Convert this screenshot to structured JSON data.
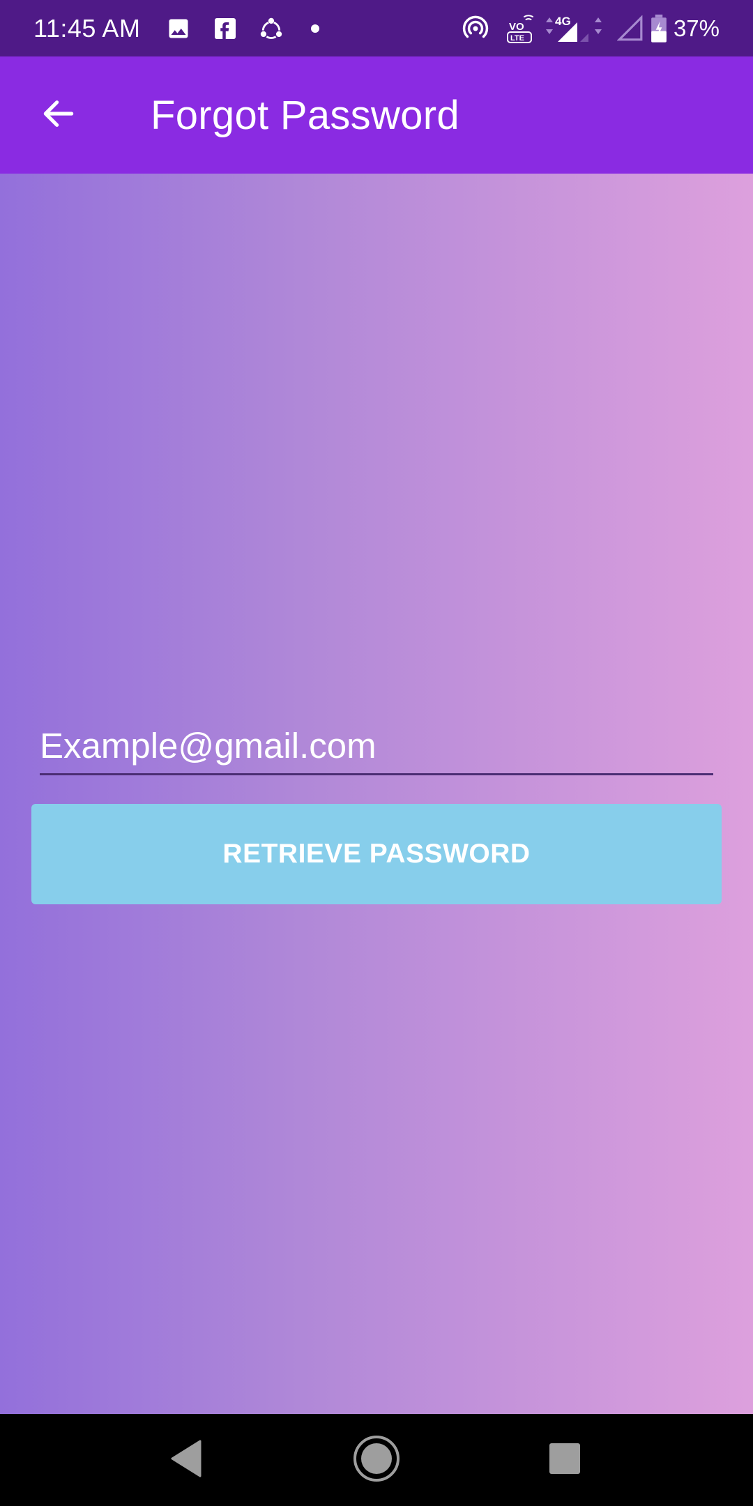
{
  "status_bar": {
    "time": "11:45 AM",
    "battery_percent": "37%",
    "network_label": "4G",
    "volte_top": "VO",
    "volte_bottom": "LTE",
    "icons": [
      "image-icon",
      "facebook-icon",
      "share-icon",
      "notification-dot-icon",
      "hotspot-icon",
      "volte-icon",
      "signal-4g-icon",
      "signal-empty-icon",
      "battery-icon"
    ]
  },
  "app_bar": {
    "title": "Forgot Password",
    "back_icon": "arrow-back-icon"
  },
  "form": {
    "email_placeholder": "Example@gmail.com",
    "email_value": "",
    "retrieve_label": "RETRIEVE PASSWORD"
  },
  "nav_bar": {
    "icons": [
      "back-triangle-icon",
      "home-circle-icon",
      "recents-square-icon"
    ]
  },
  "colors": {
    "status_bar": "#4f1a87",
    "app_bar": "#8a2be2",
    "gradient_start": "#9370db",
    "gradient_end": "#dda0dd",
    "button": "#87ceeb",
    "nav_bar": "#000000"
  }
}
